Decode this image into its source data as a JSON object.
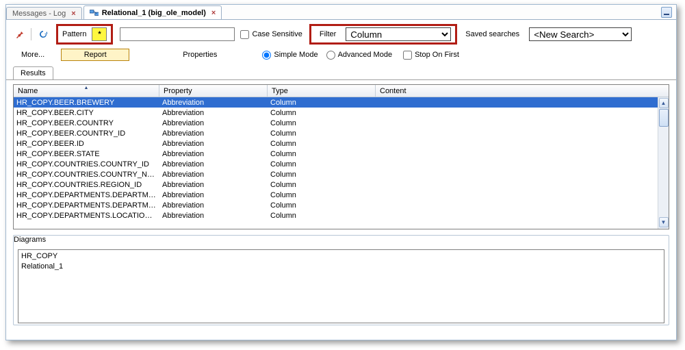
{
  "tabs": {
    "inactive": "Messages - Log",
    "active": "Relational_1 (big_ole_model)"
  },
  "toolbar": {
    "pattern_label": "Pattern",
    "pattern_value": "*",
    "search_value": "",
    "case_sensitive_label": "Case Sensitive",
    "filter_label": "Filter",
    "filter_value": "Column",
    "saved_searches_label": "Saved searches",
    "saved_search_value": "<New Search>",
    "more_label": "More...",
    "report_label": "Report",
    "properties_label": "Properties",
    "simple_mode_label": "Simple Mode",
    "advanced_mode_label": "Advanced Mode",
    "stop_on_first_label": "Stop On First"
  },
  "results_tab": "Results",
  "columns": {
    "name": "Name",
    "property": "Property",
    "type": "Type",
    "content": "Content"
  },
  "rows": [
    {
      "name": "HR_COPY.BEER.BREWERY",
      "property": "Abbreviation",
      "type": "Column",
      "content": "",
      "selected": true
    },
    {
      "name": "HR_COPY.BEER.CITY",
      "property": "Abbreviation",
      "type": "Column",
      "content": ""
    },
    {
      "name": "HR_COPY.BEER.COUNTRY",
      "property": "Abbreviation",
      "type": "Column",
      "content": ""
    },
    {
      "name": "HR_COPY.BEER.COUNTRY_ID",
      "property": "Abbreviation",
      "type": "Column",
      "content": ""
    },
    {
      "name": "HR_COPY.BEER.ID",
      "property": "Abbreviation",
      "type": "Column",
      "content": ""
    },
    {
      "name": "HR_COPY.BEER.STATE",
      "property": "Abbreviation",
      "type": "Column",
      "content": ""
    },
    {
      "name": "HR_COPY.COUNTRIES.COUNTRY_ID",
      "property": "Abbreviation",
      "type": "Column",
      "content": ""
    },
    {
      "name": "HR_COPY.COUNTRIES.COUNTRY_NAME",
      "property": "Abbreviation",
      "type": "Column",
      "content": ""
    },
    {
      "name": "HR_COPY.COUNTRIES.REGION_ID",
      "property": "Abbreviation",
      "type": "Column",
      "content": ""
    },
    {
      "name": "HR_COPY.DEPARTMENTS.DEPARTMENT...",
      "property": "Abbreviation",
      "type": "Column",
      "content": ""
    },
    {
      "name": "HR_COPY.DEPARTMENTS.DEPARTMENT...",
      "property": "Abbreviation",
      "type": "Column",
      "content": ""
    },
    {
      "name": "HR_COPY.DEPARTMENTS.LOCATION_ID",
      "property": "Abbreviation",
      "type": "Column",
      "content": ""
    }
  ],
  "diagrams": {
    "legend": "Diagrams",
    "items": [
      "HR_COPY",
      "Relational_1"
    ]
  }
}
